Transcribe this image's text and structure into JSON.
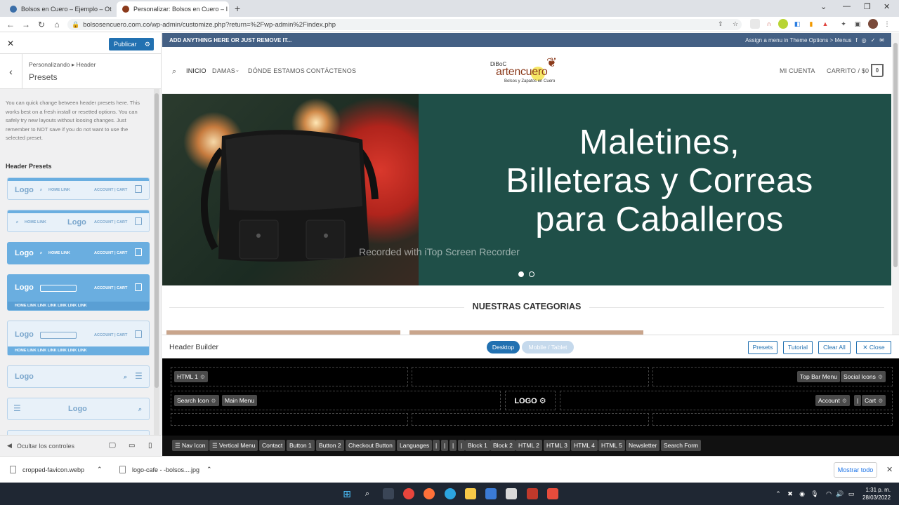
{
  "browser": {
    "tabs": [
      {
        "title": "Bolsos en Cuero – Ejemplo – Ot",
        "favicon": "wordpress-icon"
      },
      {
        "title": "Personalizar: Bolsos en Cuero – I",
        "favicon": "leaf-icon",
        "active": true
      }
    ],
    "url": "bolsosencuero.com.co/wp-admin/customize.php?return=%2Fwp-admin%2Findex.php"
  },
  "sidebar": {
    "publish_label": "Publicar",
    "breadcrumb": "Personalizando ▸ Header",
    "title": "Presets",
    "description": "You can quick change between header presets here. This works best on a fresh install or resetted options. You can safely try new layouts without loosing changes. Just remember to NOT save if you do not want to use the selected preset.",
    "presets_title": "Header Presets",
    "presets": [
      {
        "logo": "Logo",
        "left": "HOME LINK",
        "right": "ACCOUNT | CART"
      },
      {
        "logo": "Logo",
        "left": "HOME LINK",
        "right": "ACCOUNT | CART"
      },
      {
        "logo": "Logo",
        "left": "HOME LINK",
        "right": "ACCOUNT | CART"
      },
      {
        "logo": "Logo",
        "left": "",
        "right": "ACCOUNT | CART",
        "bottom": "HOME LINK    LINK LINK LINK LINK LINK"
      },
      {
        "logo": "Logo",
        "left": "",
        "right": "ACCOUNT | CART",
        "bottom": "HOME    LINK    LINK    LINK    LINK    LINK    LINK"
      },
      {
        "logo": "Logo"
      },
      {
        "logo": "Logo"
      }
    ],
    "hide_controls": "Ocultar los controles"
  },
  "preview": {
    "topbar_left": "ADD ANYTHING HERE OR JUST REMOVE IT...",
    "topbar_right": "Assign a menu in Theme Options > Menus",
    "nav": [
      "INICIO",
      "DAMAS",
      "DÓNDE ESTAMOS",
      "CONTÁCTENOS"
    ],
    "logo_top": "DiBoC",
    "logo_main": "artencuero",
    "logo_sub": "Bolsos y Zapatos en Cuero",
    "account": "MI CUENTA",
    "cart": "CARRITO / $0",
    "cart_count": "0",
    "hero_lines": [
      "Maletines,",
      "Billeteras y Correas",
      "para Caballeros"
    ],
    "watermark": "Recorded with iTop Screen Recorder",
    "section_title": "NUESTRAS CATEGORIAS",
    "colors": {
      "topbar": "#446084",
      "hero_bg": "#1f4f48",
      "primary": "#2271b1"
    }
  },
  "header_builder": {
    "title": "Header Builder",
    "desktop": "Desktop",
    "mobile": "Mobile / Tablet",
    "buttons": [
      "Presets",
      "Tutorial",
      "Clear All",
      "✕ Close"
    ],
    "row1": {
      "left": [
        "HTML 1"
      ],
      "right": [
        "Top Bar Menu",
        "Social Icons"
      ]
    },
    "row2": {
      "left": [
        "Search Icon",
        "Main Menu"
      ],
      "center": "LOGO",
      "right": [
        "Account",
        "|",
        "Cart"
      ]
    },
    "available": [
      "☰ Nav Icon",
      "☰ Vertical Menu",
      "Contact",
      "Button 1",
      "Button 2",
      "Checkout Button",
      "Languages",
      "|",
      "|",
      "|",
      "|",
      "Block 1",
      "Block 2",
      "HTML 2",
      "HTML 3",
      "HTML 4",
      "HTML 5",
      "Newsletter",
      "Search Form"
    ]
  },
  "downloads": {
    "items": [
      "cropped-favicon.webp",
      "logo-cafe - -bolsos....jpg"
    ],
    "show_all": "Mostrar todo"
  },
  "taskbar": {
    "time": "1:31 p. m.",
    "date": "28/03/2022"
  }
}
